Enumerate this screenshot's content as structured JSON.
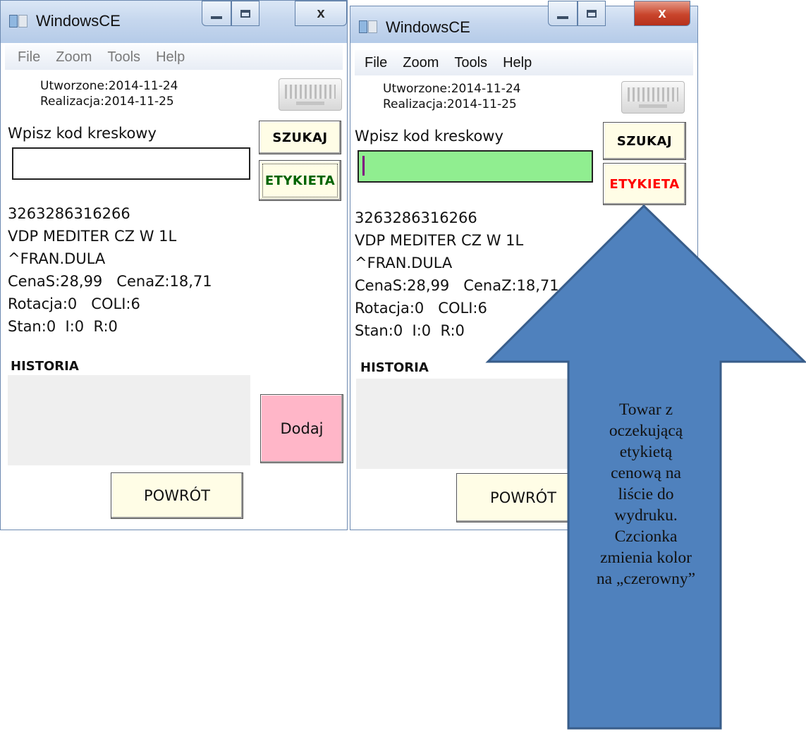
{
  "windows": [
    {
      "title": "WindowsCE",
      "controls": {
        "minimize": "minimize-icon",
        "maximize": "maximize-icon",
        "close_label": "x"
      },
      "menu": [
        "File",
        "Zoom",
        "Tools",
        "Help"
      ],
      "utworzone": "Utworzone:2014-11-24",
      "realizacja": "Realizacja:2014-11-25",
      "code_label": "Wpisz kod kreskowy",
      "code_value": "",
      "szukaj": "SZUKAJ",
      "etykieta": "ETYKIETA",
      "etykieta_color": "#006400",
      "product": {
        "barcode": "3263286316266",
        "name": "VDP MEDITER CZ W 1L",
        "supplier": "^FRAN.DULA",
        "prices": "CenaS:28,99   CenaZ:18,71",
        "rotation": "Rotacja:0   COLI:6",
        "stock": "Stan:0  I:0  R:0"
      },
      "historia": "HISTORIA",
      "dodaj": "Dodaj",
      "powrot": "POWRÓT"
    },
    {
      "title": "WindowsCE",
      "controls": {
        "minimize": "minimize-icon",
        "maximize": "maximize-icon",
        "close_label": "x"
      },
      "menu": [
        "File",
        "Zoom",
        "Tools",
        "Help"
      ],
      "utworzone": "Utworzone:2014-11-24",
      "realizacja": "Realizacja:2014-11-25",
      "code_label": "Wpisz kod kreskowy",
      "code_value": "",
      "szukaj": "SZUKAJ",
      "etykieta": "ETYKIETA",
      "etykieta_color": "#ff0000",
      "product": {
        "barcode": "3263286316266",
        "name": "VDP MEDITER CZ W 1L",
        "supplier": "^FRAN.DULA",
        "prices": "CenaS:28,99   CenaZ:18,71",
        "rotation": "Rotacja:0   COLI:6",
        "stock": "Stan:0  I:0  R:0"
      },
      "historia": "HISTORIA",
      "powrot": "POWRÓT"
    }
  ],
  "callout": {
    "lines": [
      "Towar z",
      "oczekującą",
      "etykietą",
      "cenową na",
      "liście do",
      "wydruku.",
      "Czcionka",
      "zmienia kolor",
      "na „czerowny”"
    ],
    "fill_color": "#4f81bd",
    "stroke_color": "#385d8a"
  }
}
